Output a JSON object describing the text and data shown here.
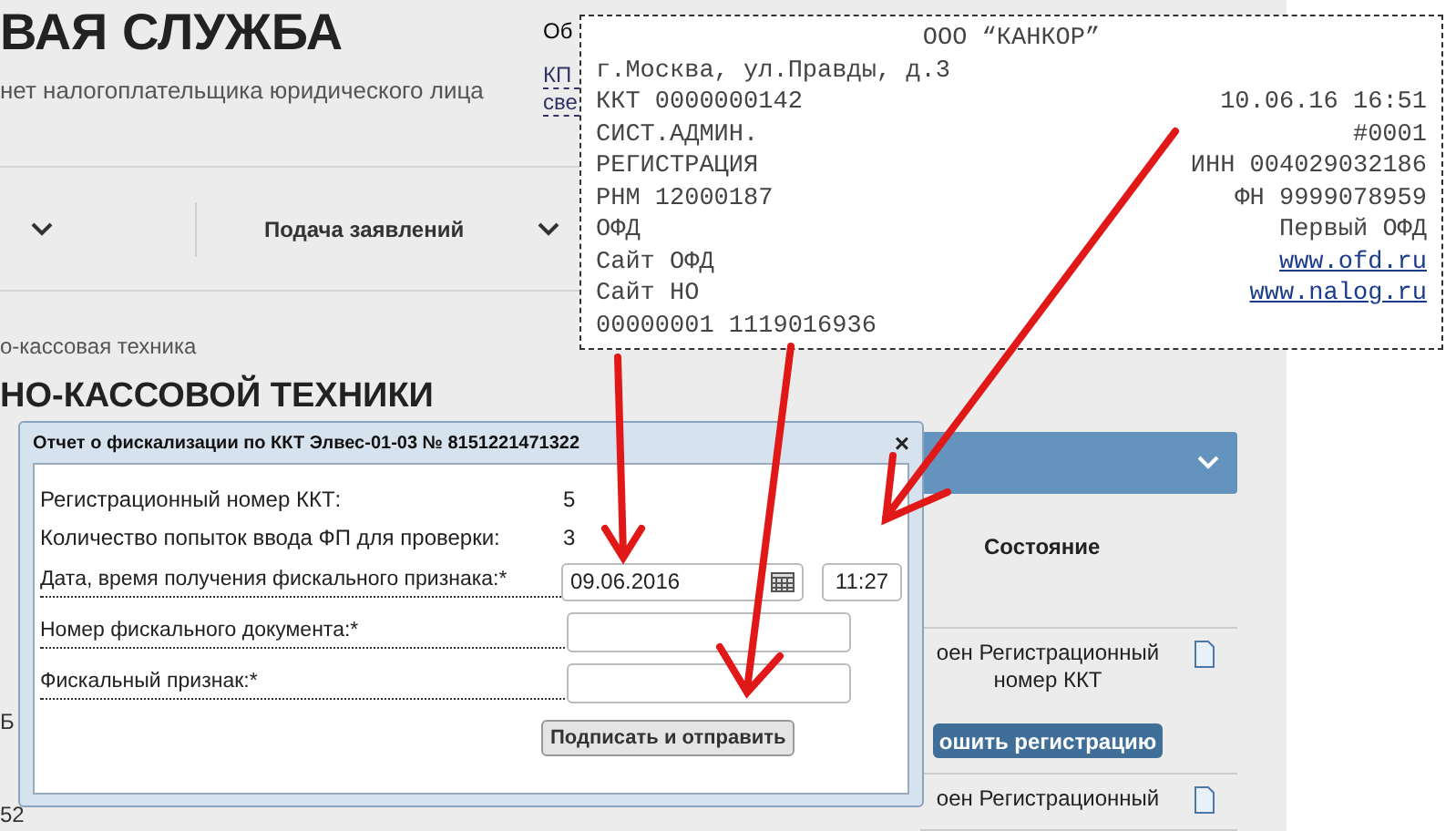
{
  "header": {
    "title": "ВАЯ СЛУЖБА",
    "subtitle": "нет налогоплательщика юридического лица"
  },
  "top_right": {
    "lines": [
      "Об"
    ],
    "links": [
      "КП",
      "све"
    ]
  },
  "nav": {
    "items": [
      {
        "label": "Подача заявлений"
      }
    ]
  },
  "breadcrumb": "о-кассовая техника",
  "heading": "НО-КАССОВОЙ ТЕХНИКИ",
  "table": {
    "header": "Состояние",
    "left_fragments": [
      "Б",
      "52"
    ],
    "rows": [
      {
        "status": "оен Регистрационный номер ККТ",
        "action": "ошить регистрацию"
      },
      {
        "status": "оен Регистрационный"
      }
    ]
  },
  "receipt": {
    "title": "ООО “КАНКОР”",
    "lines": [
      {
        "left": "г.Москва, ул.Правды, д.3"
      },
      {
        "left": "ККТ 0000000142",
        "right": "10.06.16 16:51"
      },
      {
        "left": "СИСТ.АДМИН.",
        "right": "#0001"
      },
      {
        "left": "РЕГИСТРАЦИЯ",
        "right": "ИНН 004029032186"
      },
      {
        "left": "РНМ 12000187",
        "right": "ФН 9999078959"
      },
      {
        "left": "ОФД",
        "right": "Первый ОФД"
      },
      {
        "left": "Сайт ОФД",
        "right": "www.ofd.ru",
        "kind": "link"
      },
      {
        "left": "Сайт НО",
        "right": "www.nalog.ru",
        "kind": "link"
      },
      {
        "left": "00000001 1119016936"
      }
    ]
  },
  "dialog": {
    "title": "Отчет о фискализации по ККТ Элвес-01-03 № 8151221471322",
    "info": [
      {
        "label": "Регистрационный номер ККТ:",
        "value": "5"
      },
      {
        "label": "Количество попыток ввода ФП для проверки:",
        "value": "3"
      }
    ],
    "fields": [
      {
        "kind": "datetime",
        "label": "Дата, время получения фискального признака:*",
        "value": "09.06.2016",
        "time": "11:27"
      },
      {
        "kind": "text",
        "label": "Номер фискального документа:*"
      },
      {
        "kind": "text",
        "label": "Фискальный признак:*"
      }
    ],
    "button": "Подписать и отправить",
    "close": "×"
  }
}
